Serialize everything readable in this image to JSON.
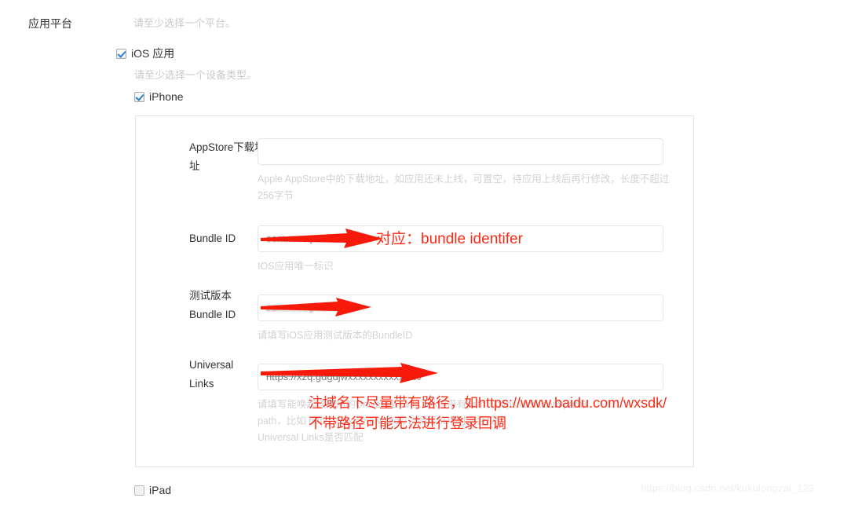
{
  "page": {
    "platform_label": "应用平台",
    "platform_hint": "请至少选择一个平台。",
    "device_hint": "请至少选择一个设备类型。",
    "watermark": "https://blog.csdn.net/kukulongzai_123"
  },
  "checkboxes": [
    {
      "label": "iOS 应用",
      "checked": true
    },
    {
      "label": "iPhone",
      "checked": true
    },
    {
      "label": "iPad",
      "checked": false
    }
  ],
  "fields": [
    {
      "label": "AppStore下载地址",
      "value": "",
      "placeholder": "",
      "help": "Apple AppStore中的下载地址，如应用还未上线，可置空，待应用上线后再行修改，长度不超过256字节"
    },
    {
      "label": "Bundle ID",
      "value": "com.xxxxp.xxxxxxxxxx",
      "placeholder": "",
      "help": "IOS应用唯一标识"
    },
    {
      "label": "测试版本 Bundle ID",
      "label_line1": "测试版本",
      "label_line2": "Bundle ID",
      "value": "com.xxxxp.xxxxxxx",
      "placeholder": "",
      "help": "请填写iOS应用测试版本的BundleID"
    },
    {
      "label": "Universal Links",
      "label_line1": "Universal",
      "label_line2": "Links",
      "value": "https://xzq.gdgdjwxxxxxxxxxxxxxx/",
      "placeholder": "",
      "help_line1": "请填写能唤起该应用的Universal Link，必须带有path（https://xxx.com/path）",
      "help_line2": "path，比如 https://xxx.com/wxsdk/，调用SDK时，会校验",
      "help_line3": "Universal Links是否匹配"
    }
  ],
  "annotations": [
    {
      "text": "对应：bundle identifer",
      "color": "#fc2a16"
    },
    {
      "text": "注域名下尽量带有路径，如https://www.baidu.com/wxsdk/",
      "color": "#fc2a16"
    },
    {
      "text": "不带路径可能无法进行登录回调",
      "color": "#fc2a16"
    }
  ],
  "colors": {
    "annotation_red": "#fc2a16",
    "checkbox_check": "#2f7fd1",
    "help_gray": "#d2d2d2",
    "panel_border": "#e4e4e4"
  }
}
